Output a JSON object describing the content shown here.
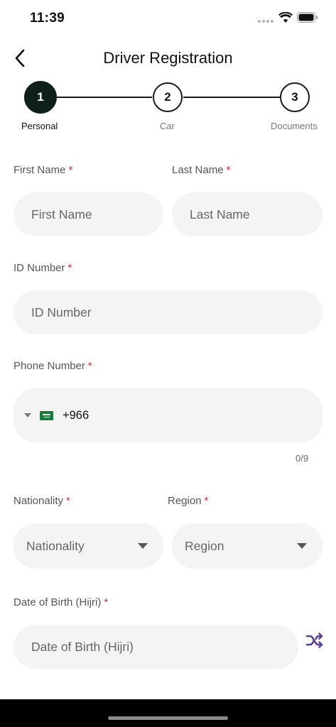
{
  "status_bar": {
    "time": "11:39"
  },
  "header": {
    "title": "Driver Registration",
    "back_icon": "chevron-left-icon"
  },
  "stepper": {
    "current_step": 1,
    "steps": [
      {
        "number": "1",
        "label": "Personal"
      },
      {
        "number": "2",
        "label": "Car"
      },
      {
        "number": "3",
        "label": "Documents"
      }
    ]
  },
  "form": {
    "required_mark": "*",
    "first_name": {
      "label": "First Name",
      "placeholder": "First Name"
    },
    "last_name": {
      "label": "Last Name",
      "placeholder": "Last Name"
    },
    "id_number": {
      "label": "ID Number",
      "placeholder": "ID Number"
    },
    "phone": {
      "label": "Phone Number",
      "country_code": "+966",
      "flag": "saudi-arabia-flag-icon",
      "counter": "0/9"
    },
    "nationality": {
      "label": "Nationality",
      "placeholder": "Nationality"
    },
    "region": {
      "label": "Region",
      "placeholder": "Region"
    },
    "dob": {
      "label": "Date of Birth (Hijri)",
      "placeholder": "Date of Birth (Hijri)",
      "toggle_icon": "shuffle-icon"
    }
  },
  "colors": {
    "active_step": "#0f1f1a",
    "required": "#d32f2f",
    "field_bg": "#f4f4f4",
    "shuffle_icon": "#5b3f8f"
  }
}
